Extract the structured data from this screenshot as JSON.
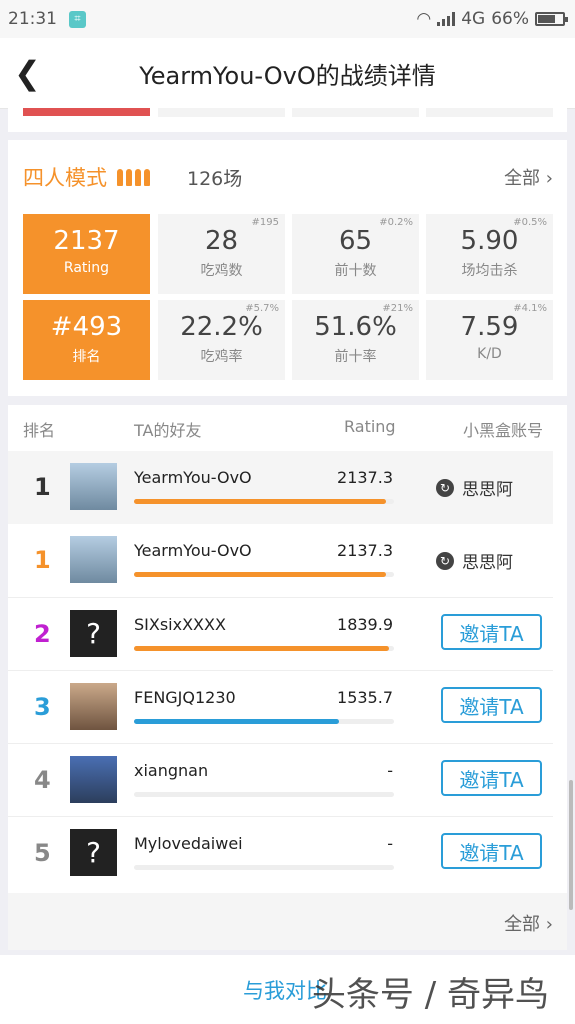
{
  "status": {
    "time": "21:31",
    "network": "4G",
    "battery": "66%"
  },
  "header": {
    "title": "YearmYou-OvO的战绩详情"
  },
  "mode": {
    "name": "四人模式",
    "count": "126场",
    "all_label": "全部"
  },
  "stats": [
    {
      "value": "2137",
      "label": "Rating",
      "rank": ""
    },
    {
      "value": "28",
      "label": "吃鸡数",
      "rank": "#195"
    },
    {
      "value": "65",
      "label": "前十数",
      "rank": "#0.2%"
    },
    {
      "value": "5.90",
      "label": "场均击杀",
      "rank": "#0.5%"
    },
    {
      "value": "#493",
      "label": "排名",
      "rank": ""
    },
    {
      "value": "22.2%",
      "label": "吃鸡率",
      "rank": "#5.7%"
    },
    {
      "value": "51.6%",
      "label": "前十率",
      "rank": "#21%"
    },
    {
      "value": "7.59",
      "label": "K/D",
      "rank": "#4.1%"
    }
  ],
  "leaderboard": {
    "headers": {
      "rank": "排名",
      "friends": "TA的好友",
      "rating": "Rating",
      "account": "小黑盒账号"
    },
    "rows": [
      {
        "rank": "1",
        "name": "YearmYou-OvO",
        "score": "2137.3",
        "progress": 0.97,
        "account": "思思阿",
        "invite": "",
        "rank_color": "#333",
        "bar_color": "#f5922b"
      },
      {
        "rank": "1",
        "name": "YearmYou-OvO",
        "score": "2137.3",
        "progress": 0.97,
        "account": "思思阿",
        "invite": "",
        "rank_color": "#f5922b",
        "bar_color": "#f5922b"
      },
      {
        "rank": "2",
        "name": "SIXsixXXXX",
        "score": "1839.9",
        "progress": 0.98,
        "account": "",
        "invite": "邀请TA",
        "rank_color": "#c020d0",
        "bar_color": "#f5922b"
      },
      {
        "rank": "3",
        "name": "FENGJQ1230",
        "score": "1535.7",
        "progress": 0.79,
        "account": "",
        "invite": "邀请TA",
        "rank_color": "#2a9dd8",
        "bar_color": "#2a9dd8"
      },
      {
        "rank": "4",
        "name": "xiangnan",
        "score": "-",
        "progress": 0,
        "account": "",
        "invite": "邀请TA",
        "rank_color": "#888",
        "bar_color": "#f5922b"
      },
      {
        "rank": "5",
        "name": "Mylovedaiwei",
        "score": "-",
        "progress": 0,
        "account": "",
        "invite": "邀请TA",
        "rank_color": "#888",
        "bar_color": "#f5922b"
      }
    ],
    "all_label": "全部"
  },
  "footer": {
    "invite_label": "与我对比",
    "watermark": "头条号 / 奇异鸟"
  }
}
